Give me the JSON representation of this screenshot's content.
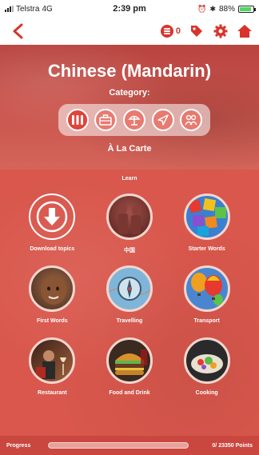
{
  "status_bar": {
    "carrier": "Telstra",
    "network": "4G",
    "time": "2:39 pm",
    "battery": "88%"
  },
  "nav": {
    "coin_count": "0",
    "accent_color": "#d9342b"
  },
  "hero": {
    "title": "Chinese (Mandarin)",
    "category_label": "Category:",
    "selected_category": "À La Carte",
    "categories": [
      {
        "icon": "percent-grid-icon",
        "active": true
      },
      {
        "icon": "briefcase-icon",
        "active": false
      },
      {
        "icon": "beach-umbrella-icon",
        "active": false
      },
      {
        "icon": "airplane-icon",
        "active": false
      },
      {
        "icon": "people-icon",
        "active": false
      }
    ]
  },
  "learn": {
    "label": "Learn",
    "topics": [
      {
        "label": "Download topics",
        "icon": "download-icon"
      },
      {
        "label": "中国",
        "icon": "terracotta-warriors-image"
      },
      {
        "label": "Starter Words",
        "icon": "alphabet-blocks-image"
      },
      {
        "label": "First Words",
        "icon": "baby-image"
      },
      {
        "label": "Travelling",
        "icon": "compass-map-image"
      },
      {
        "label": "Transport",
        "icon": "hot-air-balloons-image"
      },
      {
        "label": "Restaurant",
        "icon": "restaurant-image"
      },
      {
        "label": "Food and Drink",
        "icon": "burger-image"
      },
      {
        "label": "Cooking",
        "icon": "dish-image"
      }
    ]
  },
  "progress": {
    "label": "Progress",
    "points_text": "0/ 23350 Points",
    "value": 0
  }
}
